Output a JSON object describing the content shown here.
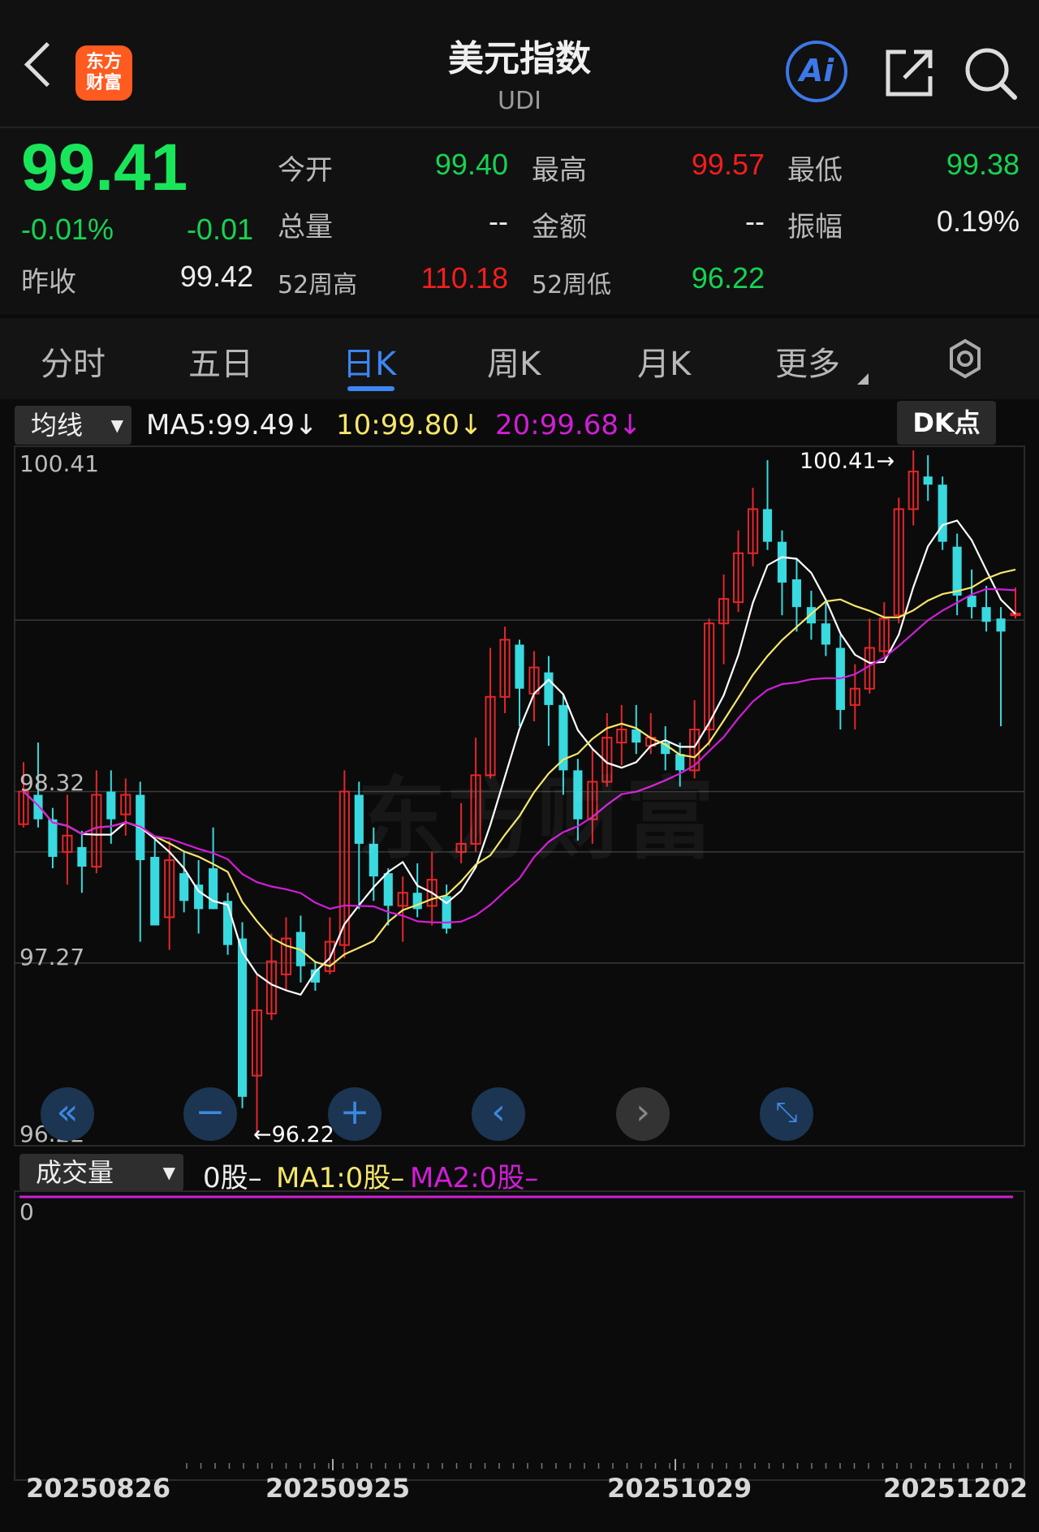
{
  "header": {
    "title": "美元指数",
    "subtitle": "UDI",
    "logo_text_line1": "东方",
    "logo_text_line2": "财富",
    "ai_label": "Ai"
  },
  "quote": {
    "price": "99.41",
    "change_pct": "-0.01%",
    "change": "-0.01",
    "prev_close_label": "昨收",
    "prev_close": "99.42",
    "open_label": "今开",
    "open": "99.40",
    "high_label": "最高",
    "high": "99.57",
    "low_label": "最低",
    "low": "99.38",
    "volume_label": "总量",
    "volume": "--",
    "amount_label": "金额",
    "amount": "--",
    "amplitude_label": "振幅",
    "amplitude": "0.19%",
    "high52_label": "52周高",
    "high52": "110.18",
    "low52_label": "52周低",
    "low52": "96.22"
  },
  "tabs": [
    "分时",
    "五日",
    "日K",
    "周K",
    "月K",
    "更多"
  ],
  "active_tab": "日K",
  "indicator": {
    "dropdown": "均线",
    "ma5": "MA5:99.49↓",
    "ma10": "10:99.80↓",
    "ma20": "20:99.68↓",
    "dk_button": "DK点"
  },
  "chart": {
    "y_labels": [
      "100.41",
      "98.32",
      "97.27",
      "96.22"
    ],
    "max_marker": "100.41→",
    "min_marker": "←96.22",
    "watermark": "东方财富",
    "dates": [
      "20250826",
      "20250925",
      "20251029",
      "20251202"
    ],
    "colors": {
      "up": "#e5262a",
      "down": "#38d9df",
      "ma5": "#ffffff",
      "ma10": "#f5e66a",
      "ma20": "#d11ed8"
    }
  },
  "volume": {
    "dropdown": "成交量",
    "value": "0股–",
    "ma1": "MA1:0股–",
    "ma2": "MA2:0股–",
    "y_label": "0"
  },
  "controls": [
    "double-left-icon",
    "zoom-out-icon",
    "zoom-in-icon",
    "prev-icon",
    "next-icon",
    "expand-icon"
  ],
  "chart_data": {
    "type": "candlestick",
    "title": "美元指数",
    "ylim": [
      96.22,
      100.41
    ],
    "y_ticks": [
      100.41,
      98.32,
      97.27,
      96.22
    ],
    "x_tick_labels": [
      "20250826",
      "20250925",
      "20251029",
      "20251202"
    ],
    "series": [
      {
        "name": "MA5",
        "latest": 99.49
      },
      {
        "name": "MA10",
        "latest": 99.8
      },
      {
        "name": "MA20",
        "latest": 99.68
      }
    ],
    "candles": [
      [
        98.12,
        98.32,
        98.5,
        98.1
      ],
      [
        98.3,
        98.15,
        98.62,
        98.1
      ],
      [
        98.15,
        97.92,
        98.22,
        97.85
      ],
      [
        97.95,
        98.05,
        98.3,
        97.75
      ],
      [
        97.98,
        97.86,
        98.08,
        97.7
      ],
      [
        97.86,
        98.3,
        98.45,
        97.82
      ],
      [
        98.32,
        98.15,
        98.45,
        98.0
      ],
      [
        98.18,
        98.3,
        98.4,
        98.05
      ],
      [
        98.3,
        97.9,
        98.38,
        97.4
      ],
      [
        97.92,
        97.5,
        98.05,
        97.5
      ],
      [
        97.55,
        97.9,
        98.02,
        97.35
      ],
      [
        97.82,
        97.65,
        97.95,
        97.58
      ],
      [
        97.75,
        97.6,
        97.9,
        97.45
      ],
      [
        97.85,
        97.6,
        98.1,
        97.6
      ],
      [
        97.65,
        97.38,
        97.7,
        97.32
      ],
      [
        97.42,
        96.45,
        97.52,
        96.38
      ],
      [
        96.58,
        96.98,
        97.2,
        96.22
      ],
      [
        96.96,
        97.28,
        97.45,
        96.92
      ],
      [
        97.2,
        97.42,
        97.55,
        97.1
      ],
      [
        97.46,
        97.25,
        97.56,
        97.15
      ],
      [
        97.23,
        97.15,
        97.28,
        97.1
      ],
      [
        97.22,
        97.4,
        97.55,
        97.2
      ],
      [
        97.38,
        98.32,
        98.45,
        97.3
      ],
      [
        98.3,
        98.0,
        98.38,
        97.6
      ],
      [
        98.0,
        97.8,
        98.1,
        97.65
      ],
      [
        97.82,
        97.62,
        97.85,
        97.5
      ],
      [
        97.62,
        97.7,
        97.8,
        97.4
      ],
      [
        97.7,
        97.6,
        97.88,
        97.55
      ],
      [
        97.62,
        97.78,
        97.95,
        97.5
      ],
      [
        97.68,
        97.48,
        97.75,
        97.45
      ],
      [
        97.95,
        98.0,
        98.25,
        97.88
      ],
      [
        98.0,
        98.42,
        98.65,
        97.95
      ],
      [
        98.42,
        98.9,
        99.2,
        98.4
      ],
      [
        98.9,
        99.25,
        99.33,
        98.8
      ],
      [
        99.22,
        98.95,
        99.25,
        98.72
      ],
      [
        98.92,
        99.08,
        99.18,
        98.75
      ],
      [
        99.05,
        98.85,
        99.15,
        98.6
      ],
      [
        98.85,
        98.45,
        98.92,
        98.3
      ],
      [
        98.45,
        98.15,
        98.52,
        98.02
      ],
      [
        98.15,
        98.38,
        98.58,
        98.0
      ],
      [
        98.38,
        98.65,
        98.8,
        98.35
      ],
      [
        98.62,
        98.7,
        98.85,
        98.48
      ],
      [
        98.7,
        98.62,
        98.85,
        98.55
      ],
      [
        98.6,
        98.65,
        98.8,
        98.55
      ],
      [
        98.62,
        98.55,
        98.72,
        98.45
      ],
      [
        98.55,
        98.45,
        98.62,
        98.35
      ],
      [
        98.45,
        98.7,
        98.88,
        98.4
      ],
      [
        98.7,
        99.35,
        99.38,
        98.6
      ],
      [
        99.35,
        99.5,
        99.65,
        99.1
      ],
      [
        99.48,
        99.78,
        99.92,
        99.42
      ],
      [
        99.78,
        100.05,
        100.18,
        99.7
      ],
      [
        100.05,
        99.85,
        100.35,
        99.8
      ],
      [
        99.85,
        99.6,
        99.92,
        99.4
      ],
      [
        99.62,
        99.45,
        99.75,
        99.3
      ],
      [
        99.45,
        99.35,
        99.55,
        99.25
      ],
      [
        99.35,
        99.22,
        99.5,
        99.15
      ],
      [
        99.2,
        98.82,
        99.28,
        98.7
      ],
      [
        98.85,
        98.95,
        99.1,
        98.7
      ],
      [
        98.95,
        99.2,
        99.38,
        98.92
      ],
      [
        99.18,
        99.38,
        99.48,
        99.15
      ],
      [
        99.4,
        100.05,
        100.12,
        99.35
      ],
      [
        100.05,
        100.28,
        100.41,
        99.95
      ],
      [
        100.25,
        100.2,
        100.38,
        100.1
      ],
      [
        100.2,
        99.85,
        100.25,
        99.8
      ],
      [
        99.82,
        99.52,
        99.9,
        99.4
      ],
      [
        99.52,
        99.45,
        99.68,
        99.38
      ],
      [
        99.45,
        99.36,
        99.58,
        99.3
      ],
      [
        99.38,
        99.3,
        99.45,
        98.72
      ],
      [
        99.4,
        99.41,
        99.57,
        99.38
      ]
    ]
  }
}
